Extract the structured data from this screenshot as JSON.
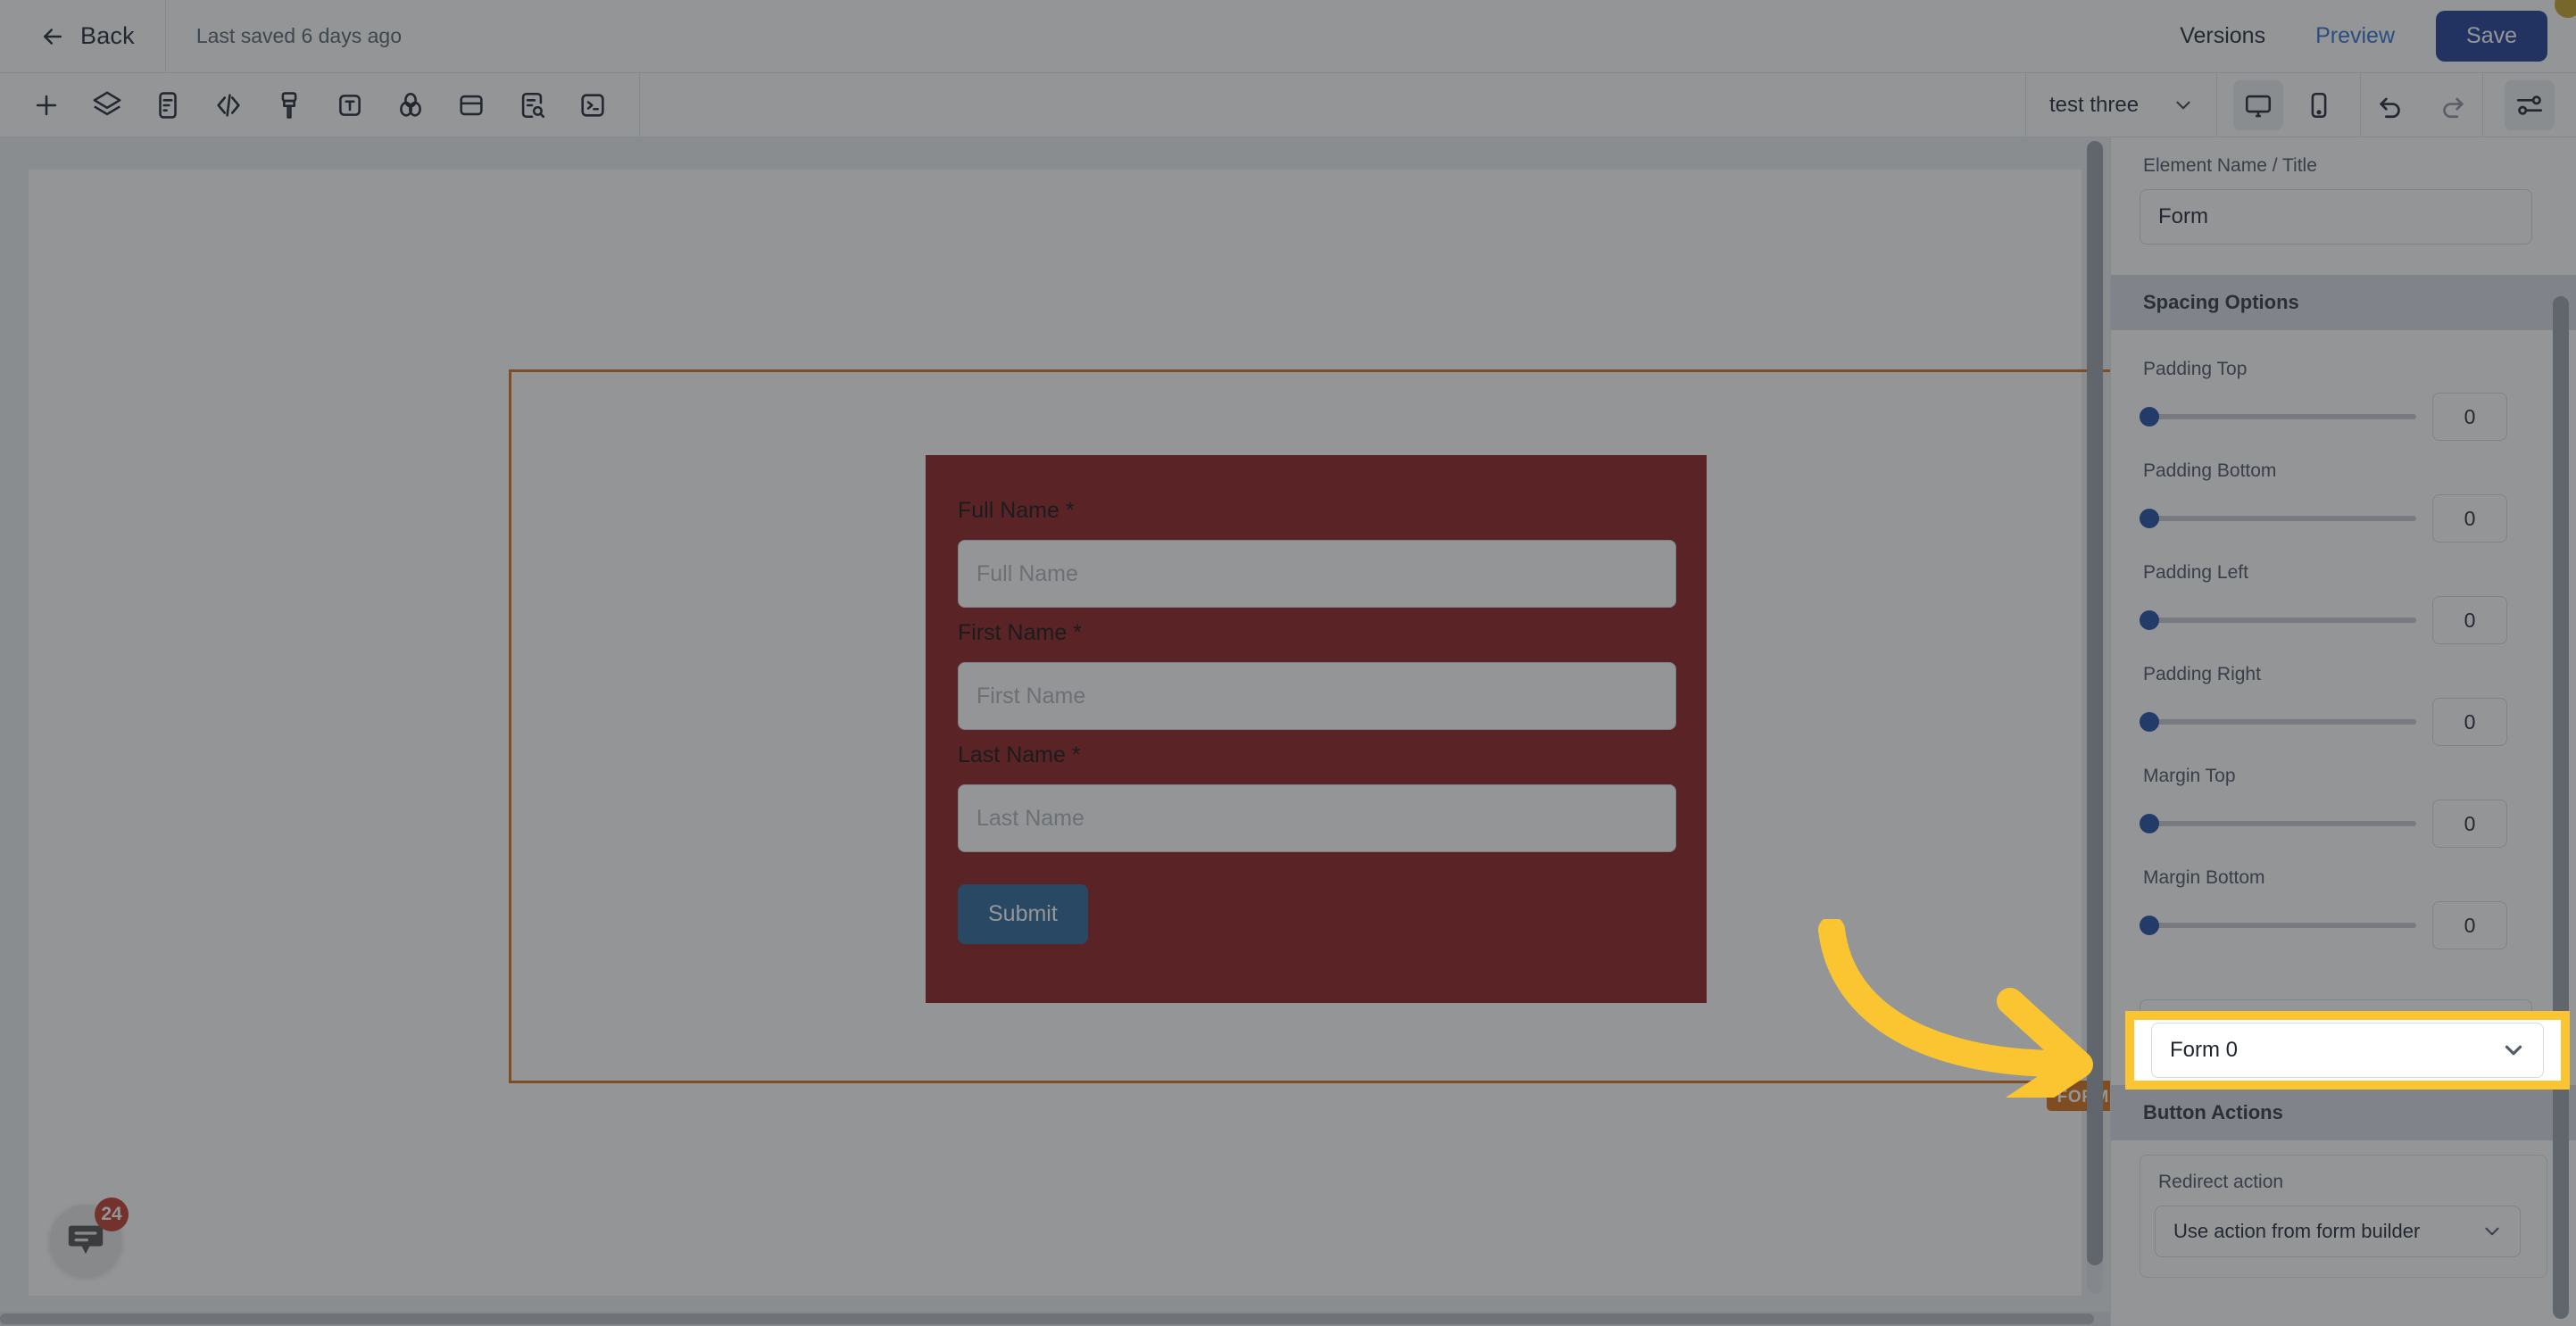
{
  "topbar": {
    "back_label": "Back",
    "back_icon": "arrow-left-icon",
    "saved_text": "Last saved 6 days ago",
    "versions_label": "Versions",
    "preview_label": "Preview",
    "save_label": "Save",
    "notification_dot_color": "#c9a227"
  },
  "toolbar": {
    "tools": [
      {
        "name": "add-element-icon",
        "title": "Add"
      },
      {
        "name": "layers-icon",
        "title": "Layers"
      },
      {
        "name": "page-content-icon",
        "title": "Content"
      },
      {
        "name": "code-icon",
        "title": "Code"
      },
      {
        "name": "brush-icon",
        "title": "Style"
      },
      {
        "name": "text-icon",
        "title": "Text"
      },
      {
        "name": "color-palette-icon",
        "title": "Colors"
      },
      {
        "name": "container-icon",
        "title": "Container"
      },
      {
        "name": "document-search-icon",
        "title": "SEO"
      },
      {
        "name": "terminal-icon",
        "title": "Script"
      }
    ],
    "page_select_value": "test three",
    "viewport_desktop_icon": "desktop-icon",
    "viewport_mobile_icon": "mobile-icon",
    "viewport_active": "desktop",
    "undo_icon": "undo-icon",
    "redo_icon": "redo-icon",
    "settings_icon": "settings-sliders-icon"
  },
  "canvas": {
    "selection_tag": "FORM",
    "selection_color": "#d96c12",
    "form": {
      "background_color": "#8c1d1d",
      "fields": [
        {
          "label": "Full Name *",
          "placeholder": "Full Name",
          "value": ""
        },
        {
          "label": "First Name *",
          "placeholder": "First Name",
          "value": ""
        },
        {
          "label": "Last Name *",
          "placeholder": "Last Name",
          "value": ""
        }
      ],
      "submit_label": "Submit",
      "submit_color": "#2a6496"
    },
    "chat_widget": {
      "badge_count": "24",
      "icon": "chat-bubble-icon"
    }
  },
  "panel": {
    "element_name_label": "Element Name / Title",
    "element_name_value": "Form",
    "spacing_section_title": "Spacing Options",
    "spacing_sliders": [
      {
        "label": "Padding Top",
        "value": "0"
      },
      {
        "label": "Padding Bottom",
        "value": "0"
      },
      {
        "label": "Padding Left",
        "value": "0"
      },
      {
        "label": "Padding Right",
        "value": "0"
      },
      {
        "label": "Margin Top",
        "value": "0"
      },
      {
        "label": "Margin Bottom",
        "value": "0"
      }
    ],
    "form_select_value": "Form 0",
    "button_actions_title": "Button Actions",
    "redirect_action_label": "Redirect action",
    "redirect_action_value": "Use action from form builder"
  },
  "annotation": {
    "highlight_color": "#fbc531",
    "arrow_color": "#fbc531",
    "arrow_icon": "curved-arrow-right-icon"
  }
}
